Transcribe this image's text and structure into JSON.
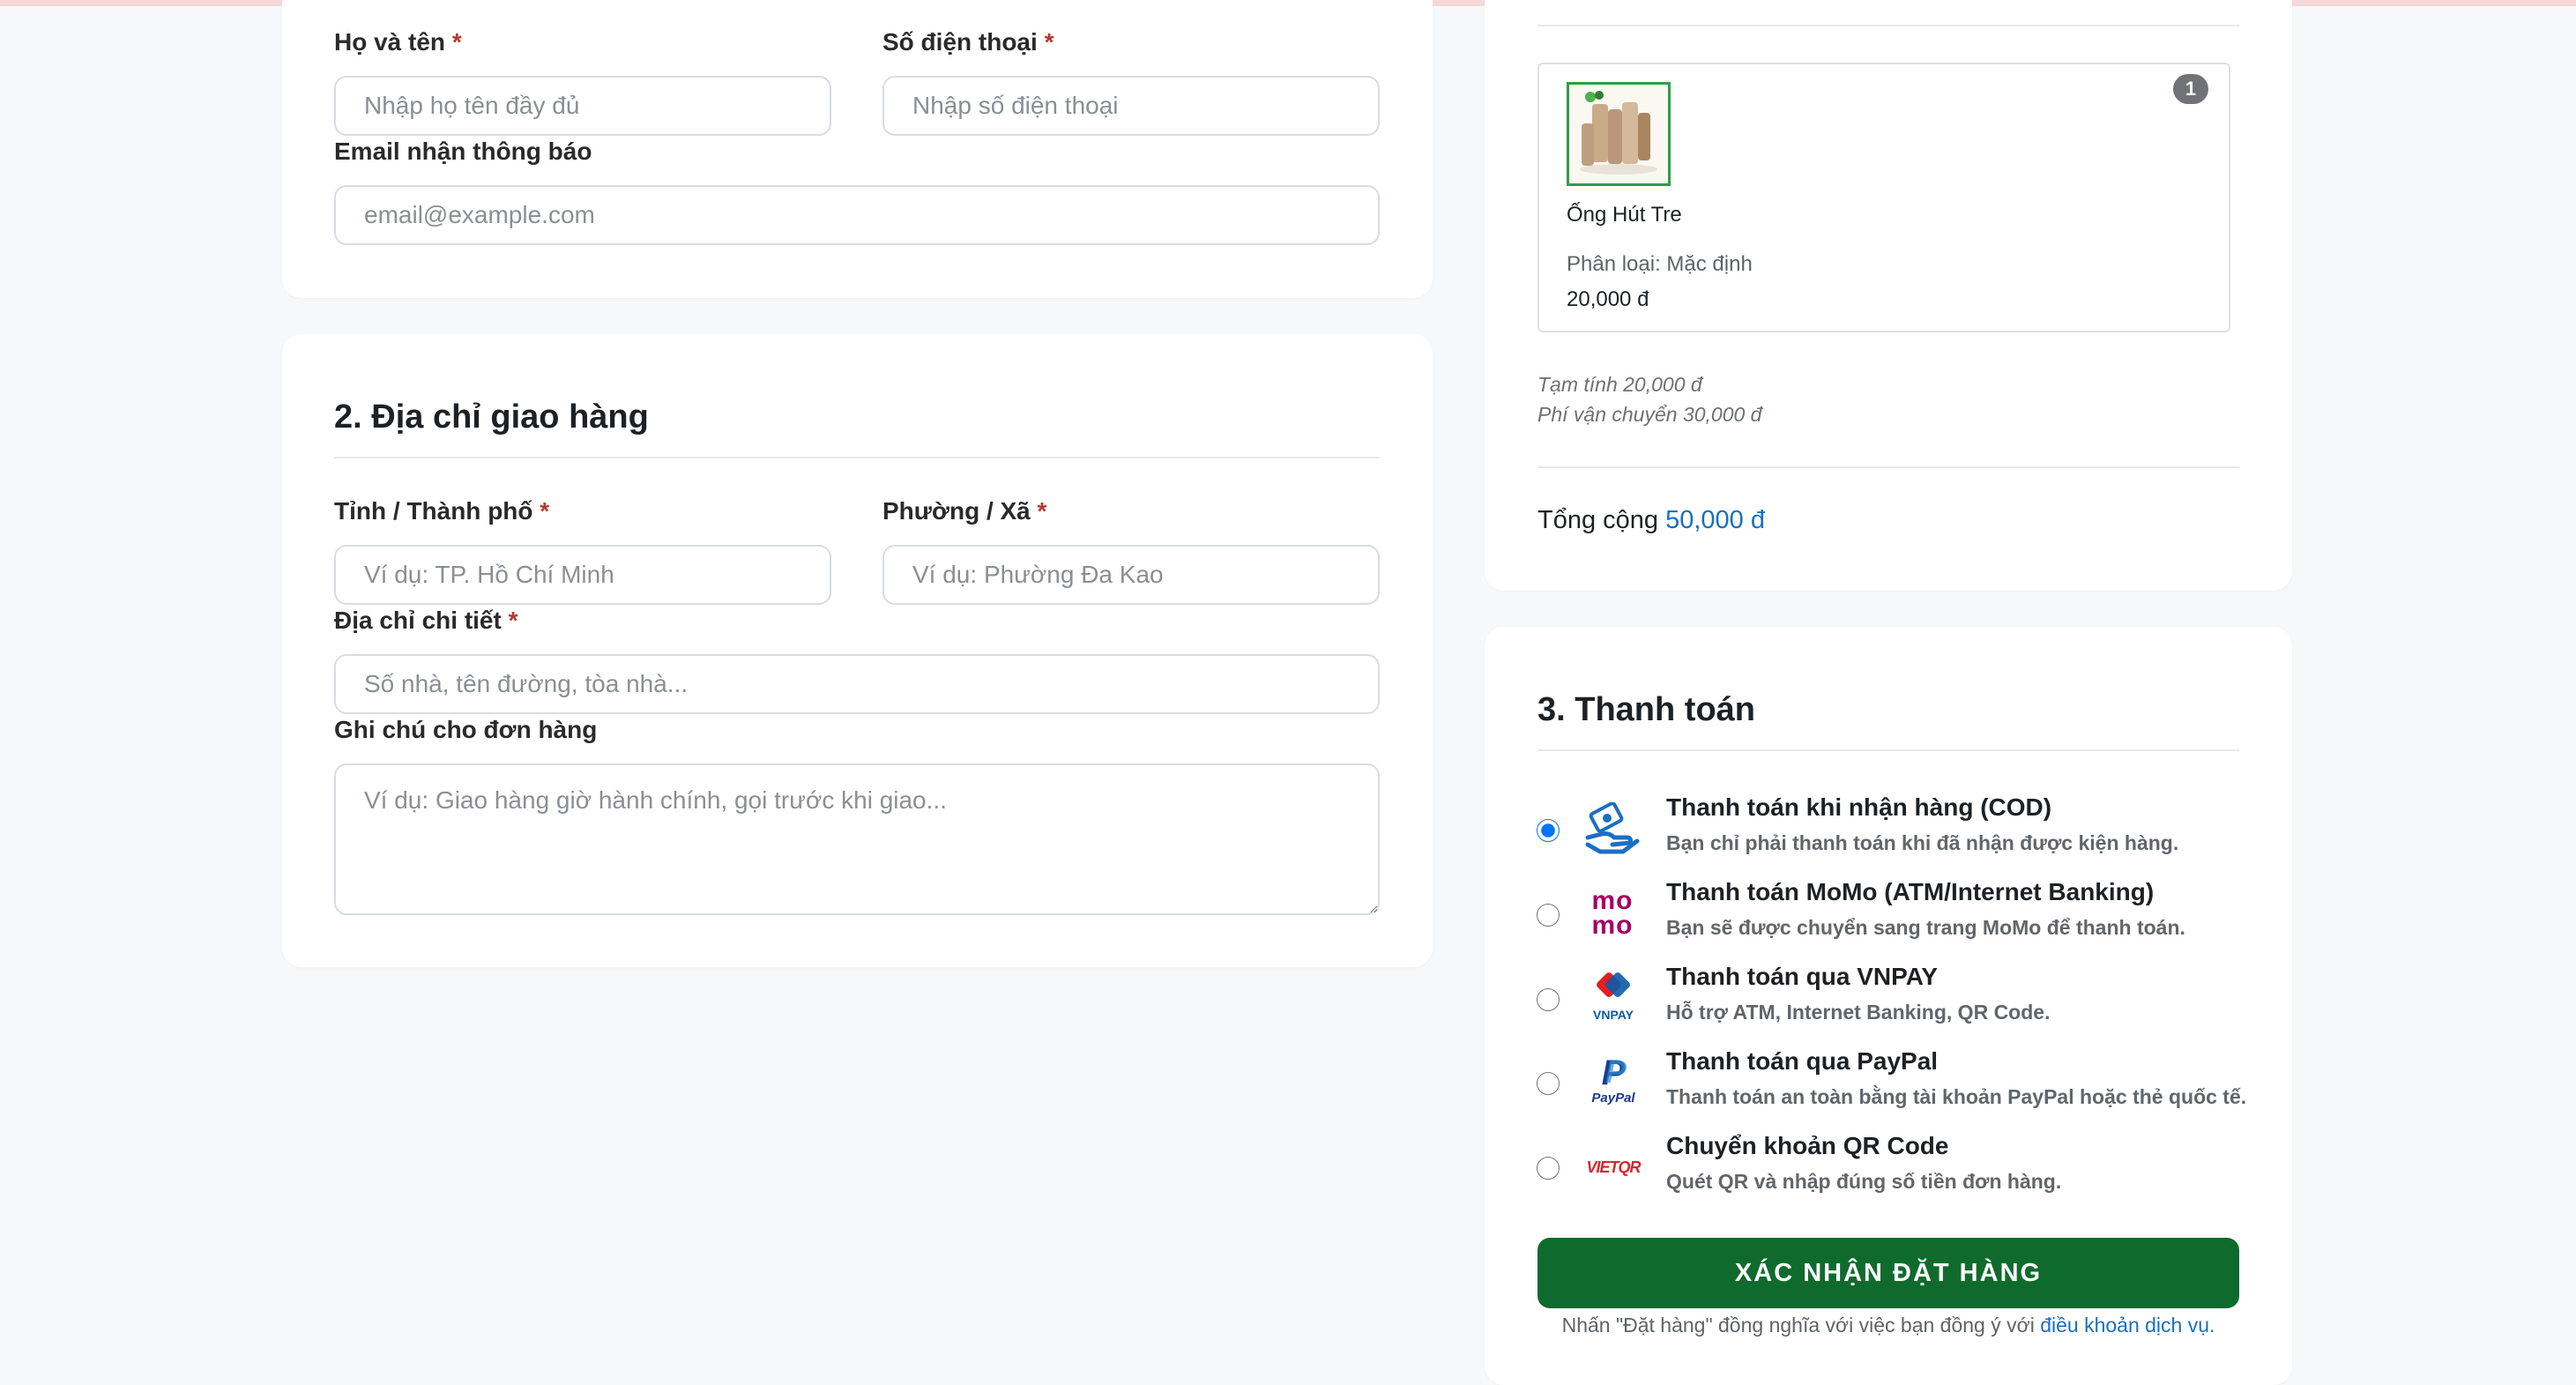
{
  "contact": {
    "name_label": "Họ và tên",
    "name_placeholder": "Nhập họ tên đầy đủ",
    "phone_label": "Số điện thoại",
    "phone_placeholder": "Nhập số điện thoại",
    "email_label": "Email nhận thông báo",
    "email_placeholder": "email@example.com",
    "required_mark": "*"
  },
  "shipping": {
    "title": "2. Địa chỉ giao hàng",
    "province_label": "Tỉnh / Thành phố",
    "province_placeholder": "Ví dụ: TP. Hồ Chí Minh",
    "ward_label": "Phường / Xã",
    "ward_placeholder": "Ví dụ: Phường Đa Kao",
    "address_label": "Địa chỉ chi tiết",
    "address_placeholder": "Số nhà, tên đường, tòa nhà...",
    "note_label": "Ghi chú cho đơn hàng",
    "note_placeholder": "Ví dụ: Giao hàng giờ hành chính, gọi trước khi giao..."
  },
  "order": {
    "item": {
      "name": "Ống Hút Tre",
      "variant": "Phân loại: Mặc định",
      "price": "20,000 đ",
      "quantity": "1"
    },
    "subtotal": "Tạm tính 20,000 đ",
    "shipping_fee": "Phí vận chuyển 30,000 đ",
    "total_label": "Tổng cộng",
    "total_value": "50,000 đ"
  },
  "payment": {
    "title": "3. Thanh toán",
    "methods": [
      {
        "title": "Thanh toán khi nhận hàng (COD)",
        "desc": "Bạn chỉ phải thanh toán khi đã nhận được kiện hàng.",
        "icon": "cod-hand-icon",
        "selected": true
      },
      {
        "title": "Thanh toán MoMo (ATM/Internet Banking)",
        "desc": "Bạn sẽ được chuyển sang trang MoMo để thanh toán.",
        "icon": "momo-icon",
        "selected": false
      },
      {
        "title": "Thanh toán qua VNPAY",
        "desc": "Hỗ trợ ATM, Internet Banking, QR Code.",
        "icon": "vnpay-icon",
        "selected": false
      },
      {
        "title": "Thanh toán qua PayPal",
        "desc": "Thanh toán an toàn bằng tài khoản PayPal hoặc thẻ quốc tế.",
        "icon": "paypal-icon",
        "selected": false
      },
      {
        "title": "Chuyển khoản QR Code",
        "desc": "Quét QR và nhập đúng số tiền đơn hàng.",
        "icon": "vietqr-icon",
        "selected": false
      }
    ],
    "momo_text": "mo",
    "vnpay_text": "VNPAY",
    "paypal_text": "PayPal",
    "vietqr_text": "VIETQR",
    "submit_label": "XÁC NHẬN ĐẶT HÀNG",
    "terms_prefix": "Nhấn \"Đặt hàng\" đồng nghĩa với việc bạn đồng ý với ",
    "terms_link": "điều khoản dịch vụ",
    "terms_suffix": "."
  },
  "colors": {
    "accent_green": "#0f6b2d",
    "link_blue": "#1a6fbf",
    "required_red": "#b23a2e"
  }
}
